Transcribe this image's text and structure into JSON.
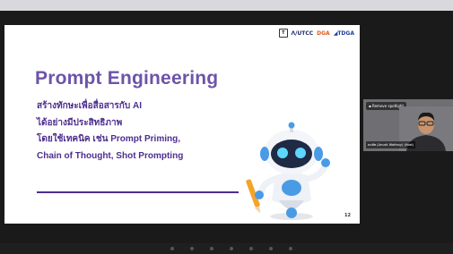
{
  "slide": {
    "logos": {
      "tfex": "T",
      "utcc": "UTCC",
      "dga": "DGA",
      "tdga": "TDGA"
    },
    "title": "Prompt Engineering",
    "lines": [
      "สร้างทักษะเพื่อสื่อสารกับ AI",
      "ได้อย่างมีประสิทธิภาพ",
      "โดยใช้เทคนิค เช่น Prompt Priming,",
      "Chain of Thought, Shot Prompting"
    ],
    "page_number": "12"
  },
  "video_tile": {
    "spotlight_label": "Remove spotlight",
    "participant_name": "ธนพัท (Anusit Wattnsy) (Host)"
  },
  "colors": {
    "title": "#6d54a8",
    "subtitle": "#4e2e8f",
    "slide_bg": "#ffffff",
    "meeting_bg": "#1a1a1a"
  }
}
